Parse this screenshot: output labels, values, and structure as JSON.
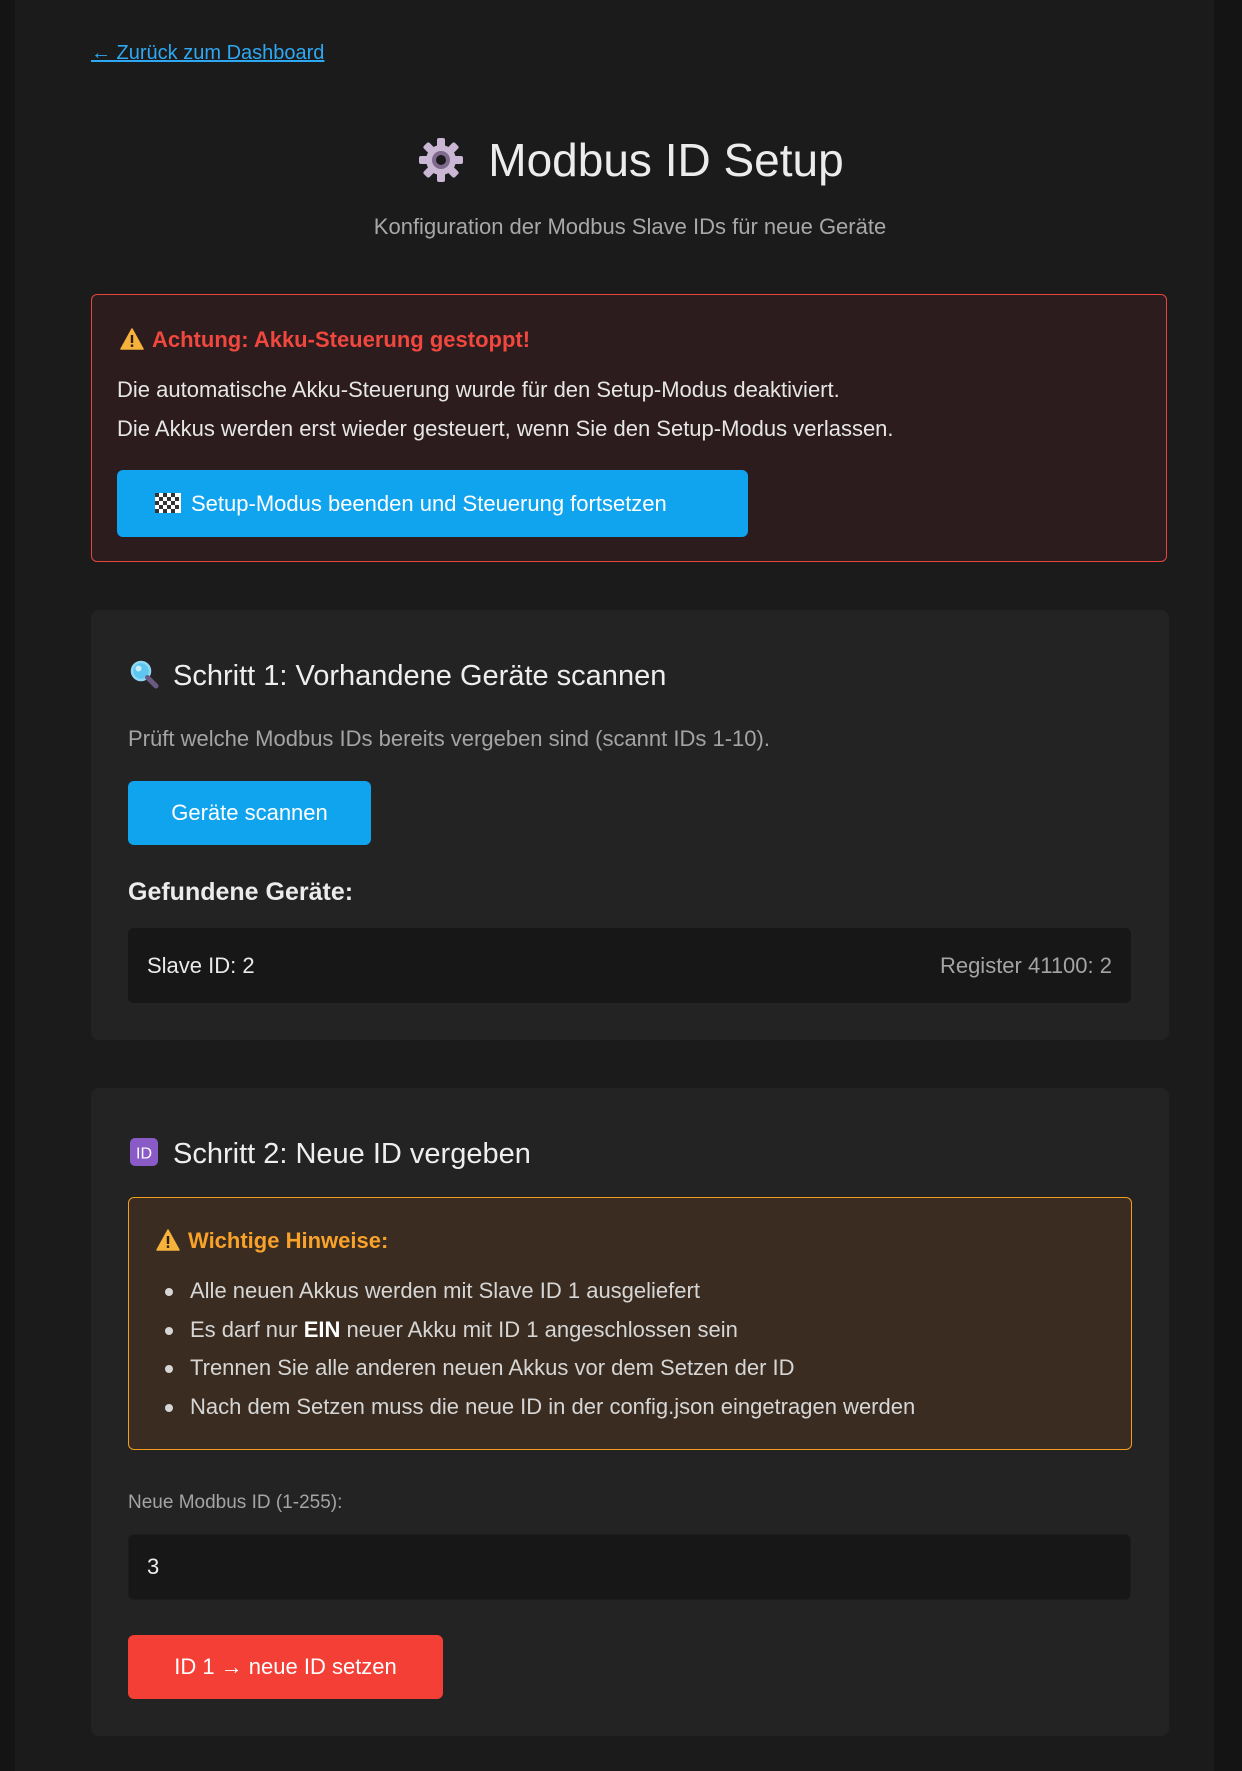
{
  "nav": {
    "back_link": "← Zurück zum Dashboard"
  },
  "header": {
    "title": "Modbus ID Setup",
    "icon": "gear-icon",
    "subtitle": "Konfiguration der Modbus Slave IDs für neue Geräte"
  },
  "alert": {
    "title": "Achtung: Akku-Steuerung gestoppt!",
    "line1": "Die automatische Akku-Steuerung wurde für den Setup-Modus deaktiviert.",
    "line2": "Die Akkus werden erst wieder gesteuert, wenn Sie den Setup-Modus verlassen.",
    "button_label": "Setup-Modus beenden und Steuerung fortsetzen",
    "button_icon": "checkered-flag-icon",
    "colors": {
      "border": "#e5473f",
      "title": "#f0473e",
      "background": "#2c1c1d"
    }
  },
  "step1": {
    "heading": "Schritt 1: Vorhandene Geräte scannen",
    "icon": "magnifier-icon",
    "description": "Prüft welche Modbus IDs bereits vergeben sind (scannt IDs 1-10).",
    "scan_button": "Geräte scannen",
    "found_label": "Gefundene Geräte:",
    "devices": [
      {
        "id_text": "Slave ID: 2",
        "register_text": "Register 41100: 2"
      }
    ]
  },
  "step2": {
    "heading": "Schritt 2: Neue ID vergeben",
    "icon": "id-badge-icon",
    "notes": {
      "title": "Wichtige Hinweise:",
      "item1": "Alle neuen Akkus werden mit Slave ID 1 ausgeliefert",
      "item2_before": "Es darf nur ",
      "item2_bold": "EIN",
      "item2_after": " neuer Akku mit ID 1 angeschlossen sein",
      "item3": "Trennen Sie alle anderen neuen Akkus vor dem Setzen der ID",
      "item4": "Nach dem Setzen muss die neue ID in der config.json eingetragen werden"
    },
    "input_label": "Neue Modbus ID (1-255):",
    "input_value": "3",
    "set_button": "ID 1 → neue ID setzen"
  },
  "colors": {
    "accent_blue": "#10a4ee",
    "danger_red": "#f43f36",
    "warning_orange": "#f39c1e",
    "link_blue": "#2ea8f2"
  }
}
